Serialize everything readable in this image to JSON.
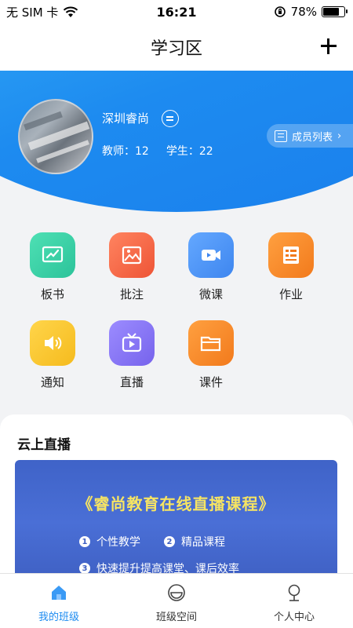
{
  "status_bar": {
    "carrier": "无 SIM 卡",
    "time": "16:21",
    "battery": "78%",
    "battery_level": 0.78
  },
  "nav": {
    "title": "学习区",
    "add_icon": "plus-icon"
  },
  "class_info": {
    "name": "深圳睿尚",
    "teachers": "教师：12",
    "students": "学生：22",
    "members_button": "成员列表"
  },
  "features": [
    {
      "label": "板书",
      "icon": "blackboard-icon",
      "color": "#3ccfa8"
    },
    {
      "label": "批注",
      "icon": "annotate-image-icon",
      "color": "#f2694b"
    },
    {
      "label": "微课",
      "icon": "video-icon",
      "color": "#4d97f4"
    },
    {
      "label": "作业",
      "icon": "homework-icon",
      "color": "#f5882a"
    },
    {
      "label": "通知",
      "icon": "speaker-icon",
      "color": "#f7c52d"
    },
    {
      "label": "直播",
      "icon": "tv-icon",
      "color": "#8877f0"
    },
    {
      "label": "课件",
      "icon": "folder-icon",
      "color": "#f5882a"
    }
  ],
  "live": {
    "section_title": "云上直播",
    "banner_title": "《睿尚教育在线直播课程》",
    "points": [
      "个性教学",
      "精品课程",
      "快速提升提高课堂、课后效率"
    ],
    "point_numbers": [
      "1",
      "2",
      "3"
    ]
  },
  "tabs": [
    {
      "label": "我的班级",
      "icon": "home-icon",
      "active": true
    },
    {
      "label": "班级空间",
      "icon": "smile-icon",
      "active": false
    },
    {
      "label": "个人中心",
      "icon": "person-icon",
      "active": false
    }
  ],
  "colors": {
    "accent": "#1d8bf0",
    "banner_text": "#f6e463"
  }
}
